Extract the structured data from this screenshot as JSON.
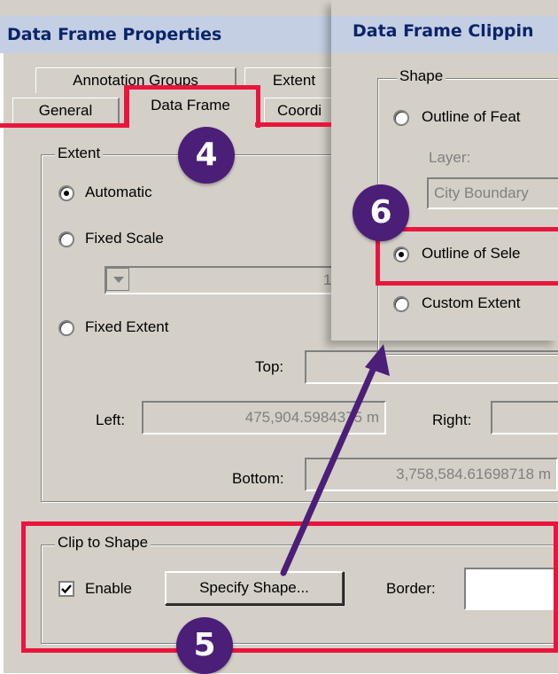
{
  "props_dialog": {
    "title": "Data Frame Properties",
    "tabs_back": [
      "Annotation Groups",
      "Extent"
    ],
    "tabs_front": [
      "General",
      "Data Frame",
      "Coordi"
    ],
    "extent_group": {
      "legend": "Extent",
      "options": [
        "Automatic",
        "Fixed Scale",
        "Fixed Extent"
      ],
      "selected": "Automatic",
      "scale_value": "1",
      "top_label": "Top:",
      "left_label": "Left:",
      "left_value": "475,904.5984375 m",
      "right_label": "Right:",
      "bottom_label": "Bottom:",
      "bottom_value": "3,758,584.61698718 m"
    },
    "clip_group": {
      "legend": "Clip to Shape",
      "enable_label": "Enable",
      "enable_checked": true,
      "specify_button": "Specify Shape...",
      "border_label": "Border:"
    }
  },
  "clipping_dialog": {
    "title": "Data Frame Clippin",
    "shape_legend": "Shape",
    "options": [
      "Outline of Feat",
      "Outline of Sele",
      "Custom Extent"
    ],
    "selected": "Outline of Sele",
    "layer_label": "Layer:",
    "layer_value": "City Boundary"
  },
  "callouts": [
    "4",
    "5",
    "6"
  ],
  "colors": {
    "highlight": "#e8163c",
    "badge": "#4b1e78",
    "arrow": "#4b1e78",
    "dialog": "#d4d0c8"
  }
}
